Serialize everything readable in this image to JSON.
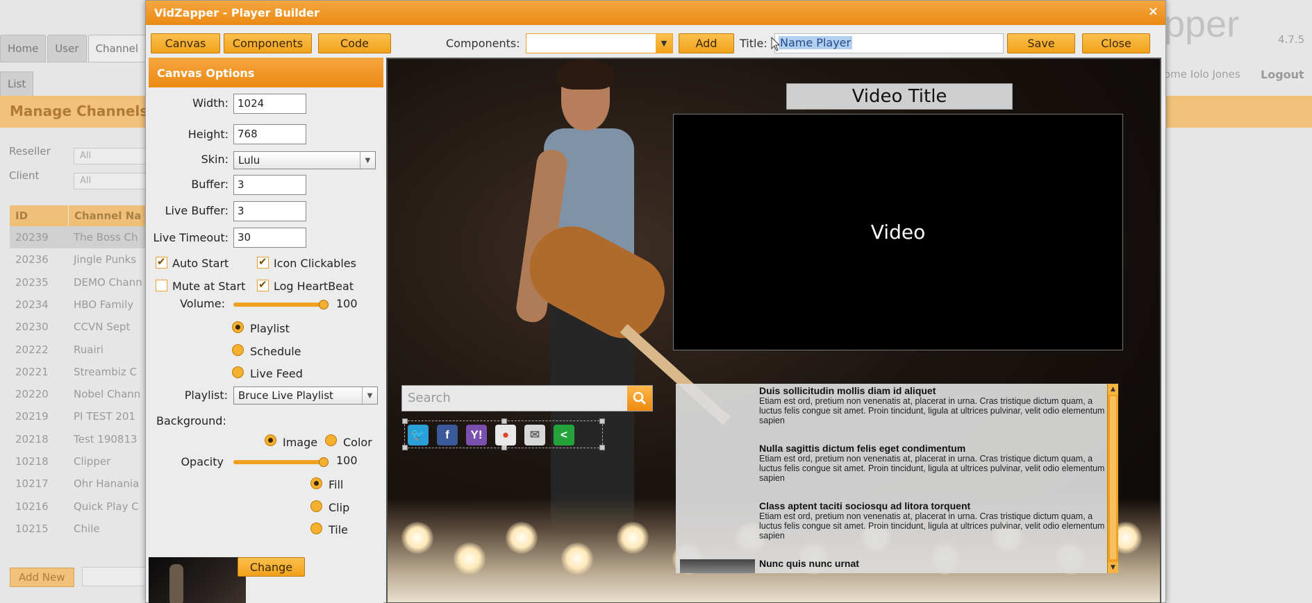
{
  "background_app": {
    "tabs": [
      "Home",
      "User",
      "Channel"
    ],
    "subtab": "List",
    "section_title": "Manage Channels",
    "filters": [
      {
        "label": "Reseller",
        "value": "All"
      },
      {
        "label": "Client",
        "value": "All"
      }
    ],
    "table_headers": [
      "ID",
      "Channel Na"
    ],
    "rows": [
      {
        "id": "20239",
        "name": "The Boss Ch"
      },
      {
        "id": "20236",
        "name": "Jingle Punks"
      },
      {
        "id": "20235",
        "name": "DEMO Chann"
      },
      {
        "id": "20234",
        "name": "HBO Family"
      },
      {
        "id": "20230",
        "name": "CCVN Sept"
      },
      {
        "id": "20222",
        "name": "Ruairi"
      },
      {
        "id": "20221",
        "name": "Streambiz C"
      },
      {
        "id": "20220",
        "name": "Nobel Chann"
      },
      {
        "id": "20219",
        "name": "PI TEST 201"
      },
      {
        "id": "20218",
        "name": "Test 190813"
      },
      {
        "id": "10218",
        "name": "Clipper"
      },
      {
        "id": "10217",
        "name": "Ohr Hanania"
      },
      {
        "id": "10216",
        "name": "Quick Play C"
      },
      {
        "id": "10215",
        "name": "Chile"
      }
    ],
    "add_new_label": "Add New",
    "logo_text": "pper",
    "version": "4.7.5",
    "user_text": "ome Iolo Jones",
    "logout_label": "Logout"
  },
  "modal": {
    "title": "VidZapper - Player Builder",
    "close_glyph": "×",
    "toolbar": {
      "canvas_label": "Canvas",
      "components_label": "Components",
      "code_label": "Code",
      "components_field_label": "Components:",
      "add_label": "Add",
      "title_field_label": "Title:",
      "title_value": "Name Player",
      "save_label": "Save",
      "close_label": "Close"
    },
    "canvas_options": {
      "header": "Canvas Options",
      "width_label": "Width:",
      "width_value": "1024",
      "height_label": "Height:",
      "height_value": "768",
      "skin_label": "Skin:",
      "skin_value": "Lulu",
      "buffer_label": "Buffer:",
      "buffer_value": "3",
      "live_buffer_label": "Live Buffer:",
      "live_buffer_value": "3",
      "live_timeout_label": "Live Timeout:",
      "live_timeout_value": "30",
      "auto_start_label": "Auto Start",
      "auto_start_checked": true,
      "icon_clickables_label": "Icon Clickables",
      "icon_clickables_checked": true,
      "mute_label": "Mute at Start",
      "mute_checked": false,
      "heartbeat_label": "Log HeartBeat",
      "heartbeat_checked": true,
      "volume_label": "Volume:",
      "volume_value": "100",
      "source_options": [
        "Playlist",
        "Schedule",
        "Live Feed"
      ],
      "source_selected": "Playlist",
      "playlist_label": "Playlist:",
      "playlist_value": "Bruce Live Playlist",
      "background_label": "Background:",
      "bg_type_options": [
        "Image",
        "Color"
      ],
      "bg_type_selected": "Image",
      "opacity_label": "Opacity",
      "opacity_value": "100",
      "fit_options": [
        "Fill",
        "Clip",
        "Tile"
      ],
      "fit_selected": "Fill",
      "change_label": "Change"
    },
    "preview": {
      "video_title": "Video Title",
      "video_label": "Video",
      "search_placeholder": "Search",
      "share_icons": [
        {
          "name": "twitter-icon",
          "glyph": "🐦",
          "color": "#2a9fd8"
        },
        {
          "name": "facebook-icon",
          "glyph": "f",
          "color": "#3b5998"
        },
        {
          "name": "yahoo-icon",
          "glyph": "Y!",
          "color": "#7b4fae"
        },
        {
          "name": "google-icon",
          "glyph": "●",
          "color": "#e8e8e8"
        },
        {
          "name": "email-icon",
          "glyph": "✉",
          "color": "#d8d8d8"
        },
        {
          "name": "share-icon",
          "glyph": "<",
          "color": "#23a33a"
        }
      ],
      "playlist_items": [
        {
          "title": "Duis sollicitudin mollis diam id aliquet",
          "desc": "Etiam est ord, pretium non venenatis at, placerat in urna. Cras tristique dictum quam, a luctus felis congue sit amet. Proin tincidunt, ligula at ultrices pulvinar, velit odio elementum sapien"
        },
        {
          "title": "Nulla sagittis dictum felis eget condimentum",
          "desc": "Etiam est ord, pretium non venenatis at, placerat in urna. Cras tristique dictum quam, a luctus felis congue sit amet. Proin tincidunt, ligula at ultrices pulvinar, velit odio elementum sapien"
        },
        {
          "title": "Class aptent taciti sociosqu ad litora torquent",
          "desc": "Etiam est ord, pretium non venenatis at, placerat in urna. Cras tristique dictum quam, a luctus felis congue sit amet. Proin tincidunt, ligula at ultrices pulvinar, velit odio elementum sapien"
        },
        {
          "title": "Nunc quis nunc urnat",
          "desc": ""
        }
      ]
    }
  },
  "colors": {
    "accent_orange": "#f2a21a",
    "header_orange": "#ea8a14"
  }
}
